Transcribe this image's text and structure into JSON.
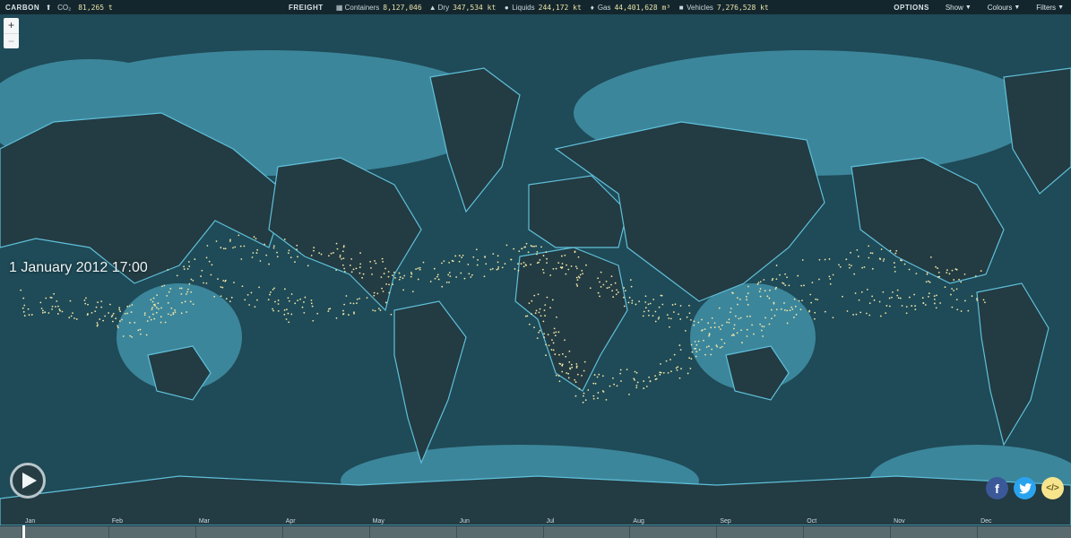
{
  "topbar": {
    "carbon": {
      "label": "CARBON",
      "co2_label": "CO₂",
      "co2_value": "81,265 t"
    },
    "freight": {
      "label": "FREIGHT",
      "stats": [
        {
          "icon": "grid-icon",
          "label": "Containers",
          "value": "8,127,046"
        },
        {
          "icon": "triangle-icon",
          "label": "Dry",
          "value": "347,534 kt"
        },
        {
          "icon": "drop-icon",
          "label": "Liquids",
          "value": "244,172 kt"
        },
        {
          "icon": "flame-icon",
          "label": "Gas",
          "value": "44,401,628 m³"
        },
        {
          "icon": "car-icon",
          "label": "Vehicles",
          "value": "7,276,528 kt"
        }
      ]
    },
    "options": {
      "label": "OPTIONS",
      "show": "Show",
      "colours": "Colours",
      "filters": "Filters"
    }
  },
  "zoom": {
    "in": "+",
    "out": "−"
  },
  "datetime": "1 January 2012 17:00",
  "timeline": {
    "months": [
      "Jan",
      "Feb",
      "Mar",
      "Apr",
      "May",
      "Jun",
      "Jul",
      "Aug",
      "Sep",
      "Oct",
      "Nov",
      "Dec"
    ],
    "progress": 0.02
  },
  "social": {
    "embed": "</>"
  },
  "colors": {
    "ocean": "#1f4a57",
    "land": "#233b42",
    "shelf": "#54b8d4",
    "ships": "#f1e6a6"
  }
}
